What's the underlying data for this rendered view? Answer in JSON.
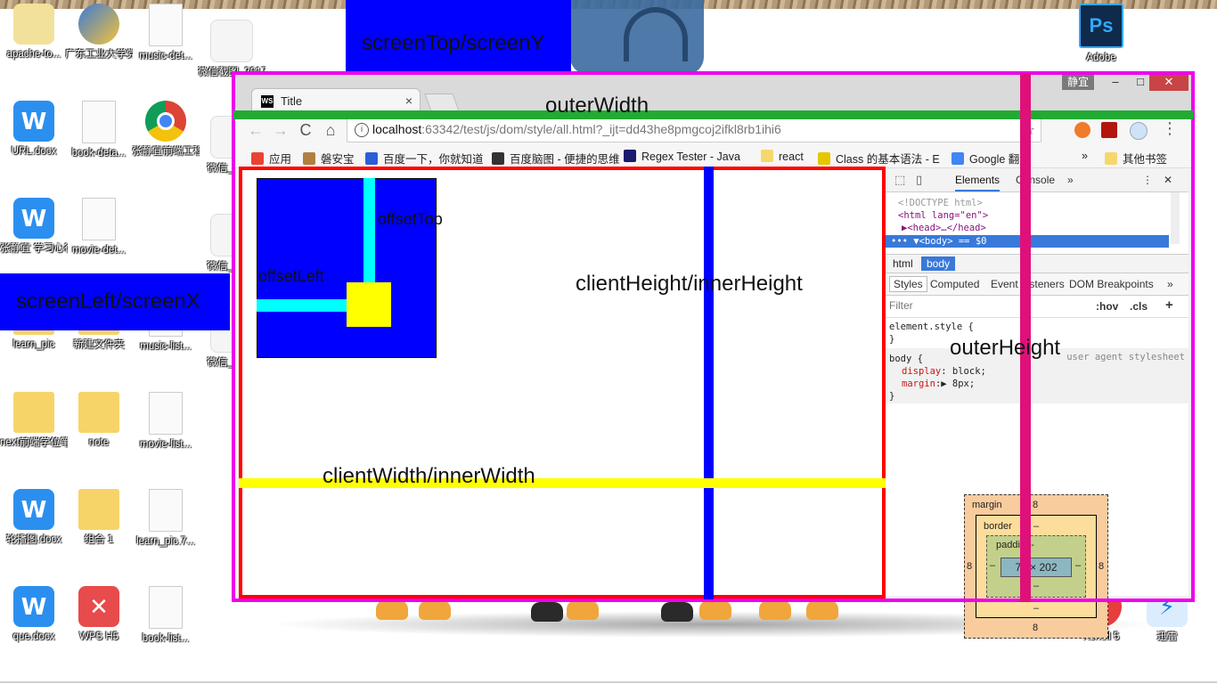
{
  "desktop": {
    "icons": [
      {
        "label": "apache-to...",
        "kind": "zip"
      },
      {
        "label": "广东工业大学党带讯...",
        "kind": "shield"
      },
      {
        "label": "music-det...",
        "kind": "doc"
      },
      {
        "label": "微信截图_2017...",
        "kind": "shot"
      },
      {
        "label": "URL.docx",
        "kind": "wps"
      },
      {
        "label": "book-deta...",
        "kind": "doc"
      },
      {
        "label": "张静宜前端工程师简...",
        "kind": "chrome"
      },
      {
        "label": "微信_2017",
        "kind": "shot"
      },
      {
        "label": "张静宜 学习心得.docx",
        "kind": "wps"
      },
      {
        "label": "movie-det...",
        "kind": "doc"
      },
      {
        "label": "微信_2017",
        "kind": "shot"
      },
      {
        "label": "learn_pic",
        "kind": "folder"
      },
      {
        "label": "新建文件夹",
        "kind": "folder"
      },
      {
        "label": "music-list...",
        "kind": "doc"
      },
      {
        "label": "微信_2017",
        "kind": "shot"
      },
      {
        "label": "next前端学位笔记",
        "kind": "folder"
      },
      {
        "label": "note",
        "kind": "folder"
      },
      {
        "label": "movie-list...",
        "kind": "doc"
      },
      {
        "label": "轮播图.docx",
        "kind": "wps"
      },
      {
        "label": "组合 1",
        "kind": "folder"
      },
      {
        "label": "learn_pic.7...",
        "kind": "doc"
      },
      {
        "label": "que.docx",
        "kind": "wps"
      },
      {
        "label": "WPS H5",
        "kind": "h5"
      },
      {
        "label": "book-list...",
        "kind": "doc"
      },
      {
        "label": "Adobe",
        "kind": "ps"
      },
      {
        "label": "Xshell 5",
        "kind": "xshell"
      },
      {
        "label": "迅雷",
        "kind": "thunder"
      }
    ]
  },
  "browser": {
    "user_chip": "静宜",
    "tab": {
      "title": "Title",
      "close": "×",
      "favicon": "WS"
    },
    "window_controls": {
      "minimize": "–",
      "maximize": "□",
      "close": "✕"
    },
    "toolbar": {
      "back": "←",
      "forward": "→",
      "reload": "C",
      "home": "⌂",
      "url_host": "localhost",
      "url_path": ":63342/test/js/dom/style/all.html?_ijt=dd43he8pmgcoj2ifkl8rb1ihi6",
      "star": "☆",
      "menu": "⋮"
    },
    "bookmarks": [
      {
        "label": "应用",
        "color": "#e94235"
      },
      {
        "label": "磐安宝",
        "color": "#b08040"
      },
      {
        "label": "百度一下，你就知道",
        "color": "#2b5fd9"
      },
      {
        "label": "百度脑图 - 便捷的思维",
        "color": "#333333"
      },
      {
        "label": "Regex Tester - Java",
        "color": "#1a1a6e"
      },
      {
        "label": "react",
        "color": "#f5d76e"
      },
      {
        "label": "Class 的基本语法 - E",
        "color": "#e5c700"
      },
      {
        "label": "Google 翻译",
        "color": "#4285f4"
      },
      {
        "label": "»",
        "color": ""
      },
      {
        "label": "其他书签",
        "color": "#f5d76e"
      }
    ]
  },
  "devtools": {
    "tabs": {
      "elements": "Elements",
      "console": "Console",
      "more": "»",
      "menu": "⋮",
      "close": "✕"
    },
    "dom_lines": [
      "<!DOCTYPE html>",
      "<html lang=\"en\">",
      "▶<head>…</head>"
    ],
    "dom_selected": "••• ▼<body> == $0",
    "crumbs": [
      "html",
      "body"
    ],
    "subtabs": [
      "Styles",
      "Computed",
      "Event Listeners",
      "DOM Breakpoints",
      "»"
    ],
    "filter": {
      "placeholder": "Filter",
      "hov": ":hov",
      "cls": ".cls",
      "add": "+"
    },
    "styles": {
      "element_style": "element.style {",
      "close1": "}",
      "body_sel": "body {",
      "ua_note": "user agent stylesheet",
      "prop1": "display",
      "val1": ": block;",
      "prop2": "margin",
      "val2": ":▶ 8px;",
      "close2": "}"
    },
    "box_model": {
      "margin_label": "margin",
      "margin_top": "8",
      "margin_bottom": "8",
      "margin_left": "8",
      "margin_right": "8",
      "border_label": "border",
      "border_dash": "–",
      "padding_label": "padding-",
      "content": "70 × 202",
      "dash_left": "–",
      "dash_right": "–",
      "dash_pad_bottom": "–",
      "dash_border_bottom": "–"
    }
  },
  "annotations": {
    "screen_top": "screenTop/screenY",
    "screen_left": "screenLeft/screenX",
    "outer_width": "outerWidth",
    "outer_height": "outerHeight",
    "offset_top": "offsetTop",
    "offset_left": "offsetLeft",
    "client_height": "clientHeight/innerHeight",
    "client_width": "clientWidth/innerWidth"
  },
  "colors": {
    "screen_blue": "#0000ff",
    "outer_frame": "#ee00ee",
    "outer_width_bar": "#22aa33",
    "outer_height_bar": "#e0107a",
    "viewport_frame": "#ff0000",
    "cyan": "#00ffff",
    "yellow": "#ffff00"
  }
}
